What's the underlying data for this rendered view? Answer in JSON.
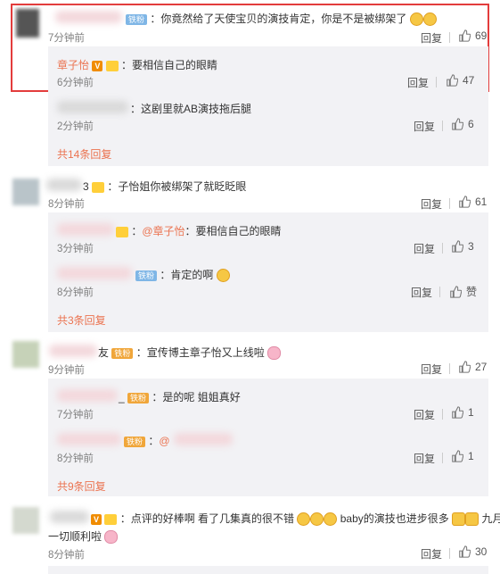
{
  "common": {
    "reply_label": "回复",
    "iron_fan_badge": "铁粉"
  },
  "comments": [
    {
      "text": "：你竟然给了天使宝贝的演技肯定，你是不是被绑架了",
      "time": "7分钟前",
      "likes": "69"
    },
    {
      "text": "：子怡姐你被绑架了就眨眨眼",
      "name_fragment": "3",
      "time": "8分钟前",
      "likes": "61"
    },
    {
      "name_fragment": "友",
      "text": "：宣传博主章子怡又上线啦",
      "time": "9分钟前",
      "likes": "27"
    },
    {
      "text": "：点评的好棒啊 看了几集真的很不错",
      "text2": "baby的演技也进步很多",
      "text3": "九月",
      "text4": "一切顺利啦",
      "time": "8分钟前",
      "likes": "30"
    }
  ],
  "replies": [
    {
      "name": "章子怡",
      "text": "：要相信自己的眼睛",
      "time": "6分钟前",
      "likes": "47"
    },
    {
      "text": "：这剧里就AB演技拖后腿",
      "time": "2分钟前",
      "likes": "6"
    },
    {
      "mention": "@章子怡",
      "text": "：要相信自己的眼睛",
      "time": "3分钟前",
      "likes": "3"
    },
    {
      "text": "：肯定的啊",
      "time": "8分钟前",
      "likes": "赞"
    },
    {
      "name_fragment": "_",
      "text": "：是的呢 姐姐真好",
      "time": "7分钟前",
      "likes": "1"
    },
    {
      "mention": "@",
      "time": "8分钟前",
      "likes": "1"
    }
  ],
  "more_replies": [
    "共14条回复",
    "共3条回复",
    "共9条回复"
  ]
}
